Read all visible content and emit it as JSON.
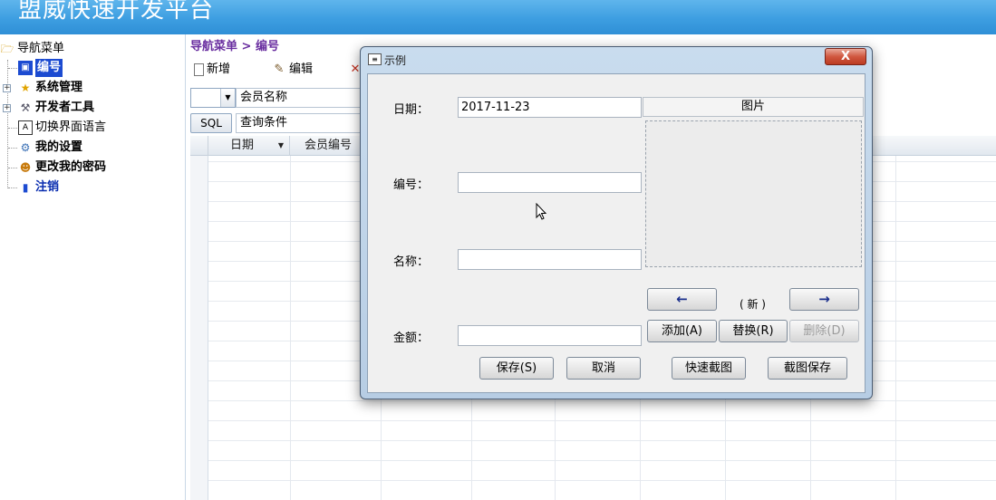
{
  "app": {
    "title": "盟威快速开发平台"
  },
  "nav": {
    "root": "导航菜单",
    "items": [
      {
        "label": "编号"
      },
      {
        "label": "系统管理"
      },
      {
        "label": "开发者工具"
      },
      {
        "label": "切换界面语言"
      },
      {
        "label": "我的设置"
      },
      {
        "label": "更改我的密码"
      },
      {
        "label": "注销"
      }
    ]
  },
  "main": {
    "breadcrumb": "导航菜单 > 编号",
    "toolbar": {
      "new_label": "新增",
      "edit_label": "编辑"
    },
    "filter": {
      "field_label": "会员名称",
      "sql_label": "SQL",
      "condition_label": "查询条件"
    },
    "grid": {
      "columns": [
        "日期",
        "会员编号"
      ]
    }
  },
  "dialog": {
    "title": "示例",
    "close_label": "X",
    "fields": {
      "date_label": "日期：",
      "date_value": "2017-11-23",
      "number_label": "编号：",
      "number_value": "",
      "name_label": "名称：",
      "name_value": "",
      "amount_label": "金额：",
      "amount_value": ""
    },
    "image": {
      "title": "图片",
      "status": "( 新 )",
      "add_label": "添加(A)",
      "replace_label": "替换(R)",
      "delete_label": "删除(D)"
    },
    "buttons": {
      "save_label": "保存(S)",
      "cancel_label": "取消",
      "quick_capture_label": "快速截图",
      "capture_save_label": "截图保存"
    }
  }
}
